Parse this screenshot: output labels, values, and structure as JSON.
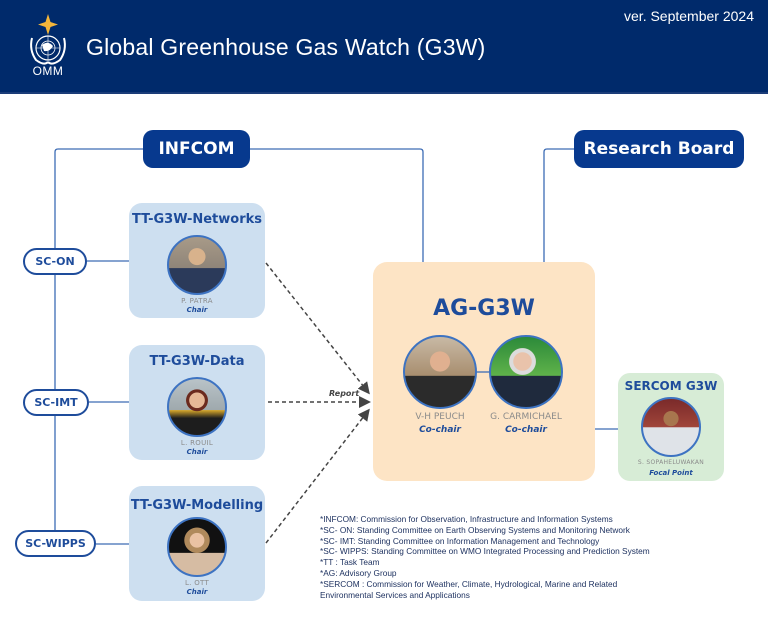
{
  "header": {
    "title": "Global Greenhouse Gas Watch (G3W)",
    "version": "ver. September 2024",
    "logo_text": "OMM",
    "logo_icon": "wmo-emblem-icon",
    "colors": {
      "background": "#002a6b",
      "logo_star": "#f5b63a"
    }
  },
  "bodies": {
    "infcom": "INFCOM",
    "research_board": "Research Board"
  },
  "committees": [
    {
      "label": "SC-ON"
    },
    {
      "label": "SC-IMT"
    },
    {
      "label": "SC-WIPPS"
    }
  ],
  "task_teams": [
    {
      "title": "TT-G3W-Networks",
      "person": "P. PATRA",
      "role": "Chair"
    },
    {
      "title": "TT-G3W-Data",
      "person": "L. ROUIL",
      "role": "Chair"
    },
    {
      "title": "TT-G3W-Modelling",
      "person": "L. OTT",
      "role": "Chair"
    }
  ],
  "advisory_group": {
    "title": "AG-G3W",
    "members": [
      {
        "person": "V-H PEUCH",
        "role": "Co-chair"
      },
      {
        "person": "G. CARMICHAEL",
        "role": "Co-chair"
      }
    ]
  },
  "sercom": {
    "title": "SERCOM G3W",
    "person": "S. SOPAHELUWAKAN",
    "role": "Focal Point"
  },
  "report_label": "Report",
  "legend": [
    "*INFCOM: Commission for Observation, Infrastructure and Information Systems",
    "*SC- ON: Standing Committee on Earth Observing Systems and Monitoring Network",
    "*SC- IMT: Standing Committee on Information Management and Technology",
    "*SC- WIPPS: Standing Committee on WMO Integrated Processing and Prediction System",
    "*TT : Task Team",
    "*AG: Advisory Group",
    "*SERCOM :  Commission for Weather, Climate, Hydrological, Marine and Related",
    "Environmental Services and Applications"
  ],
  "colors": {
    "dark_blue": "#07398e",
    "line_blue": "#3d6cb5",
    "tt_box": "#cddff0",
    "ag_box": "#fde4c5",
    "sercom_box": "#d7ecd6",
    "text_blue": "#1e4c9b"
  }
}
